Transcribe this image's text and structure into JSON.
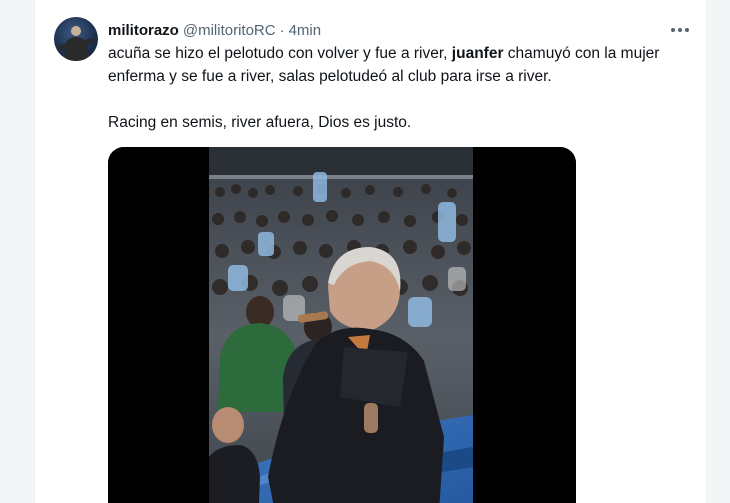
{
  "tweet": {
    "display_name": "militorazo",
    "handle": "@militoritoRC",
    "separator": "·",
    "time": "4min",
    "text": {
      "line1_part1": "acuña se hizo el pelotudo con volver y fue a river, ",
      "line1_bold": "juanfer",
      "line1_part2": " chamuyó con la mujer enferma y se fue a river, salas pelotudeó al club para irse a river.",
      "line2": "Racing en semis, river afuera, Dios es justo."
    }
  },
  "icons": {
    "more": "more-horizontal-icon"
  },
  "colors": {
    "text_primary": "#0f1419",
    "text_secondary": "#536471",
    "media_background": "#000000",
    "stadium_blue": "#2f6bb8",
    "jacket_green": "#2e6b3c"
  }
}
